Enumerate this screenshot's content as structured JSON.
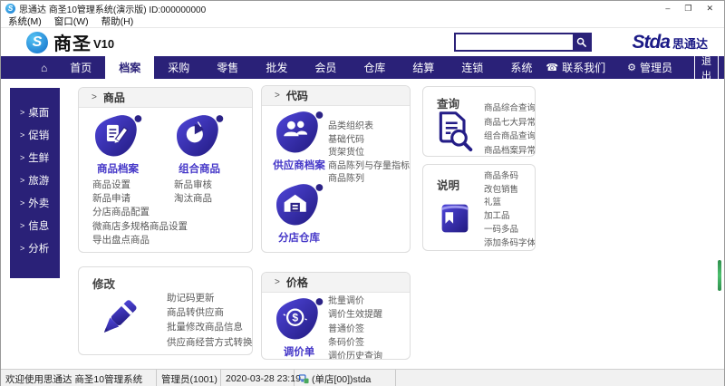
{
  "ui": {
    "arrow": ">"
  },
  "titlebar": {
    "title": "思通达 商圣10管理系统(演示版) ID:000000000",
    "minimize": "–",
    "restore": "❐",
    "close": "✕"
  },
  "menubar": {
    "items": [
      "系统(M)",
      "窗口(W)",
      "帮助(H)"
    ]
  },
  "header": {
    "logo_s": "S",
    "product": "商圣",
    "version": "V10",
    "search_placeholder": "",
    "brand": "Stda",
    "brand_cn": "思通达"
  },
  "navbar": {
    "home": "⌂",
    "items": [
      "首页",
      "档案",
      "采购",
      "零售",
      "批发",
      "会员",
      "仓库",
      "结算",
      "连锁",
      "系统"
    ],
    "active_item": "档案",
    "phone": "☎",
    "contact": "联系我们",
    "gear": "⚙",
    "admin": "管理员",
    "logout": "退出"
  },
  "sidebar": {
    "items": [
      "桌面",
      "促销",
      "生鲜",
      "旅游",
      "外卖",
      "信息",
      "分析"
    ]
  },
  "cards": {
    "product": {
      "title": "商品",
      "features": [
        {
          "label": "商品档案"
        },
        {
          "label": "组合商品"
        }
      ],
      "links_left": [
        "商品设置",
        "新品申请",
        "分店商品配置",
        "微商店多规格商品设置",
        "导出盘点商品"
      ],
      "links_right": [
        "新品审核",
        "淘汰商品"
      ]
    },
    "code": {
      "title": "代码",
      "features": [
        {
          "label": "供应商档案"
        },
        {
          "label": "分店仓库"
        }
      ],
      "links": [
        "品类组织表",
        "基础代码",
        "货架货位",
        "商品陈列与存量指标",
        "商品陈列"
      ]
    },
    "query": {
      "title": "查询",
      "links": [
        "商品综合查询",
        "商品七大异常",
        "组合商品查询",
        "商品档案异常"
      ]
    },
    "manual": {
      "title": "说明",
      "links": [
        "商品条码",
        "改包销售",
        "礼篮",
        "加工品",
        "一码多品",
        "添加条码字体"
      ]
    },
    "modify": {
      "title": "修改",
      "links": [
        "助记码更新",
        "商品转供应商",
        "批量修改商品信息",
        "供应商经营方式转换"
      ]
    },
    "price": {
      "title": "价格",
      "feature": {
        "label": "调价单"
      },
      "links": [
        "批量调价",
        "调价生效提醒",
        "普通价签",
        "条码价签",
        "调价历史查询"
      ]
    }
  },
  "statusbar": {
    "welcome": "欢迎使用思通达 商圣10管理系统",
    "user": "管理员(1001)",
    "datetime": "2020-03-28 23:19",
    "store": "(单店[00])stda"
  },
  "colors": {
    "navy": "#2a2178",
    "icon_gradient_start": "#4f46da",
    "icon_gradient_end": "#221a80",
    "feature_label_purple": "#4537c8",
    "brand_blue": "#1b1a86",
    "scrollbar_green": "#3fa45c"
  }
}
